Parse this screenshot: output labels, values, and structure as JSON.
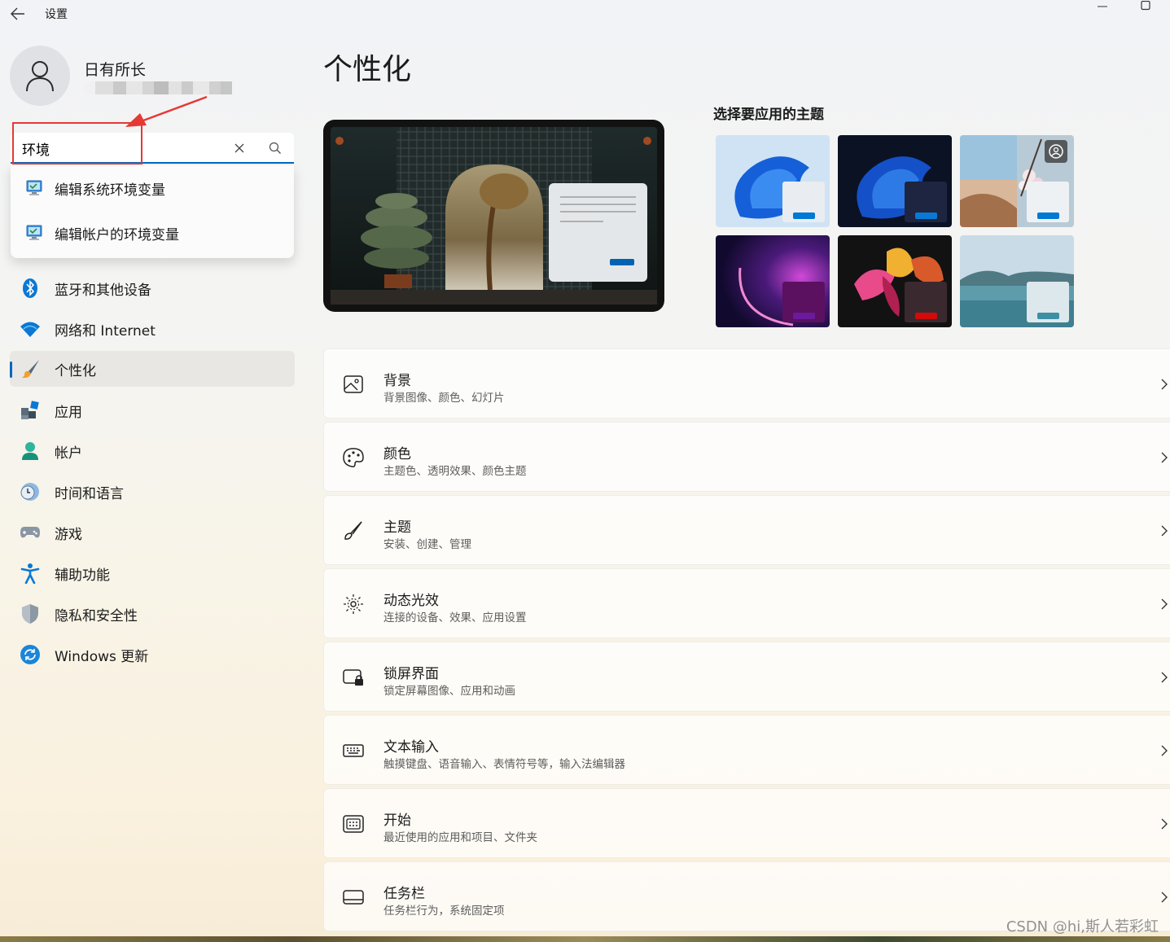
{
  "window": {
    "title": "设置"
  },
  "profile": {
    "name": "日有所长"
  },
  "search": {
    "value": "环境",
    "placeholder": ""
  },
  "suggestions": [
    {
      "label": "编辑系统环境变量"
    },
    {
      "label": "编辑帐户的环境变量"
    }
  ],
  "nav": {
    "items": [
      {
        "label": "蓝牙和其他设备",
        "icon": "bluetooth-icon"
      },
      {
        "label": "网络和 Internet",
        "icon": "wifi-icon"
      },
      {
        "label": "个性化",
        "icon": "brush-icon",
        "active": true
      },
      {
        "label": "应用",
        "icon": "apps-icon"
      },
      {
        "label": "帐户",
        "icon": "account-icon"
      },
      {
        "label": "时间和语言",
        "icon": "time-language-icon"
      },
      {
        "label": "游戏",
        "icon": "gamepad-icon"
      },
      {
        "label": "辅助功能",
        "icon": "accessibility-icon"
      },
      {
        "label": "隐私和安全性",
        "icon": "shield-icon"
      },
      {
        "label": "Windows 更新",
        "icon": "update-icon"
      }
    ]
  },
  "main": {
    "title": "个性化",
    "themes_title": "选择要应用的主题",
    "cards": [
      {
        "title": "背景",
        "subtitle": "背景图像、颜色、幻灯片",
        "icon": "image-icon"
      },
      {
        "title": "颜色",
        "subtitle": "主题色、透明效果、颜色主题",
        "icon": "palette-icon"
      },
      {
        "title": "主题",
        "subtitle": "安装、创建、管理",
        "icon": "brush-icon"
      },
      {
        "title": "动态光效",
        "subtitle": "连接的设备、效果、应用设置",
        "icon": "lighting-icon"
      },
      {
        "title": "锁屏界面",
        "subtitle": "锁定屏幕图像、应用和动画",
        "icon": "lock-screen-icon"
      },
      {
        "title": "文本输入",
        "subtitle": "触摸键盘、语音输入、表情符号等，输入法编辑器",
        "icon": "keyboard-icon"
      },
      {
        "title": "开始",
        "subtitle": "最近使用的应用和项目、文件夹",
        "icon": "start-icon"
      },
      {
        "title": "任务栏",
        "subtitle": "任务栏行为，系统固定项",
        "icon": "taskbar-icon"
      }
    ]
  },
  "colors": {
    "accent": "#0067c0",
    "annotation": "#e53935"
  },
  "watermark": "CSDN @hi,斯人若彩虹"
}
